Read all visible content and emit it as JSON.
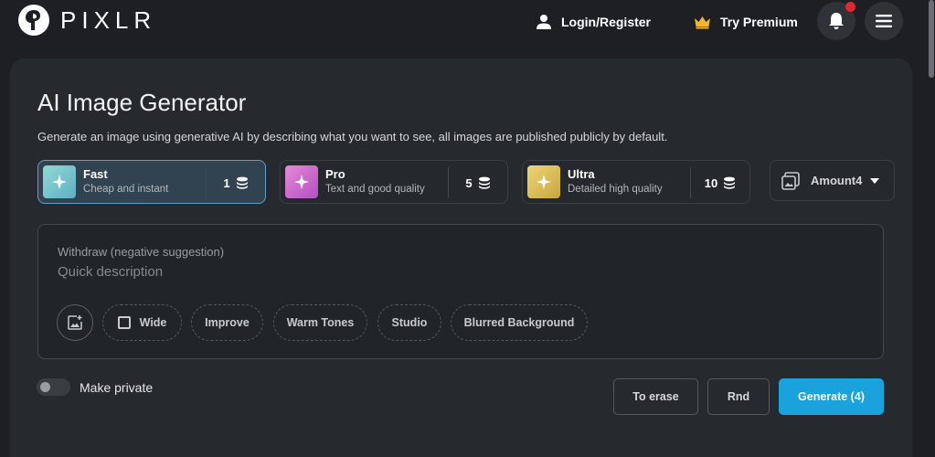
{
  "brand": {
    "name": "PIXLR"
  },
  "nav": {
    "login_label": "Login/Register",
    "premium_label": "Try Premium"
  },
  "page": {
    "title": "AI Image Generator",
    "subtitle": "Generate an image using generative AI by describing what you want to see, all images are published publicly by default."
  },
  "modes": [
    {
      "name": "Fast",
      "description": "Cheap and instant",
      "cost": "1",
      "selected": true,
      "color": "#7ec9c6"
    },
    {
      "name": "Pro",
      "description": "Text and good quality",
      "cost": "5",
      "selected": false,
      "color": "#d86ad0"
    },
    {
      "name": "Ultra",
      "description": "Detailed high quality",
      "cost": "10",
      "selected": false,
      "color": "#d9bf57"
    }
  ],
  "amount": {
    "label": "Amount4"
  },
  "prompt": {
    "negative_label": "Withdraw (negative suggestion)",
    "placeholder": "Quick description",
    "value": ""
  },
  "chips": [
    "Wide",
    "Improve",
    "Warm Tones",
    "Studio",
    "Blurred Background"
  ],
  "private_toggle": {
    "label": "Make private",
    "on": false
  },
  "actions": {
    "erase_label": "To erase",
    "random_label": "Rnd",
    "generate_label": "Generate (4)"
  },
  "colors": {
    "accent": "#1aa2dc",
    "notification": "#e0262f",
    "crown": "#f3b72c"
  },
  "icons": [
    "user-icon",
    "crown-icon",
    "bell-icon",
    "hamburger-menu-icon",
    "sparkle-icon",
    "coins-icon",
    "image-icon",
    "chevron-down-icon",
    "add-image-icon",
    "checkbox-icon"
  ]
}
